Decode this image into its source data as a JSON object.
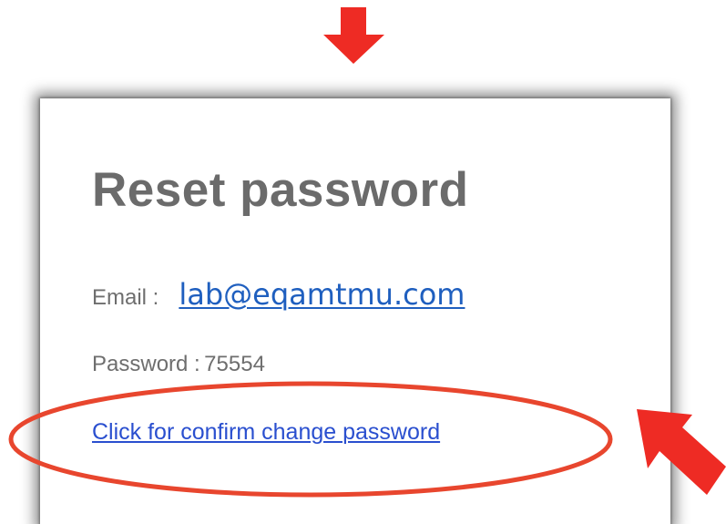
{
  "card": {
    "title": "Reset password",
    "email_label": "Email :",
    "email_value": "lab@eqamtmu.com",
    "password_label": "Password :",
    "password_value": "75554",
    "confirm_link_text": "Click for confirm change password"
  },
  "annotation": {
    "color": "#ee2b24",
    "ellipse_color": "#e8462e",
    "marks": [
      "arrow-down-icon",
      "arrow-pointer-icon",
      "highlight-ellipse"
    ]
  }
}
